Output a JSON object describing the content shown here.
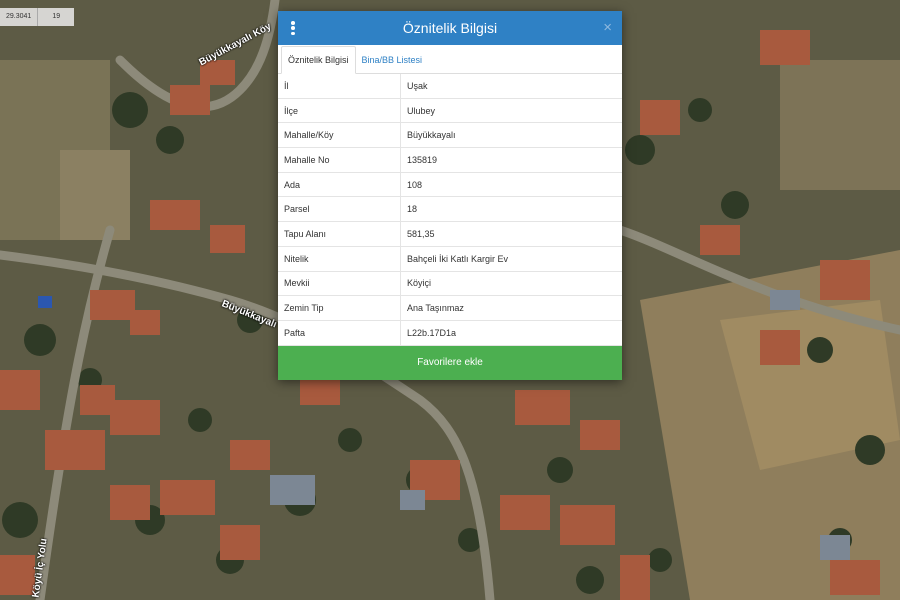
{
  "map": {
    "coord_value": "29.3041",
    "zoom_value": "19",
    "road_labels": [
      "Büyükkayalı Köy",
      "Büyükkayalı",
      "Köyü İç Yolu"
    ]
  },
  "modal": {
    "title": "Öznitelik Bilgisi",
    "menu_icon": "kebab-menu-icon",
    "close_icon": "×",
    "tabs": [
      {
        "label": "Öznitelik Bilgisi",
        "active": true
      },
      {
        "label": "Bina/BB Listesi",
        "active": false
      }
    ],
    "rows": [
      {
        "key": "İl",
        "value": "Uşak"
      },
      {
        "key": "İlçe",
        "value": "Ulubey"
      },
      {
        "key": "Mahalle/Köy",
        "value": "Büyükkayalı"
      },
      {
        "key": "Mahalle No",
        "value": "135819"
      },
      {
        "key": "Ada",
        "value": "108"
      },
      {
        "key": "Parsel",
        "value": "18"
      },
      {
        "key": "Tapu Alanı",
        "value": "581,35"
      },
      {
        "key": "Nitelik",
        "value": "Bahçeli İki Katlı Kargir Ev"
      },
      {
        "key": "Mevkii",
        "value": "Köyiçi"
      },
      {
        "key": "Zemin Tip",
        "value": "Ana Taşınmaz"
      },
      {
        "key": "Pafta",
        "value": "L22b.17D1a"
      }
    ],
    "favorite_button": "Favorilere ekle"
  },
  "colors": {
    "header": "#2f81c5",
    "button": "#4caf50",
    "tab_link": "#2f81c5"
  }
}
